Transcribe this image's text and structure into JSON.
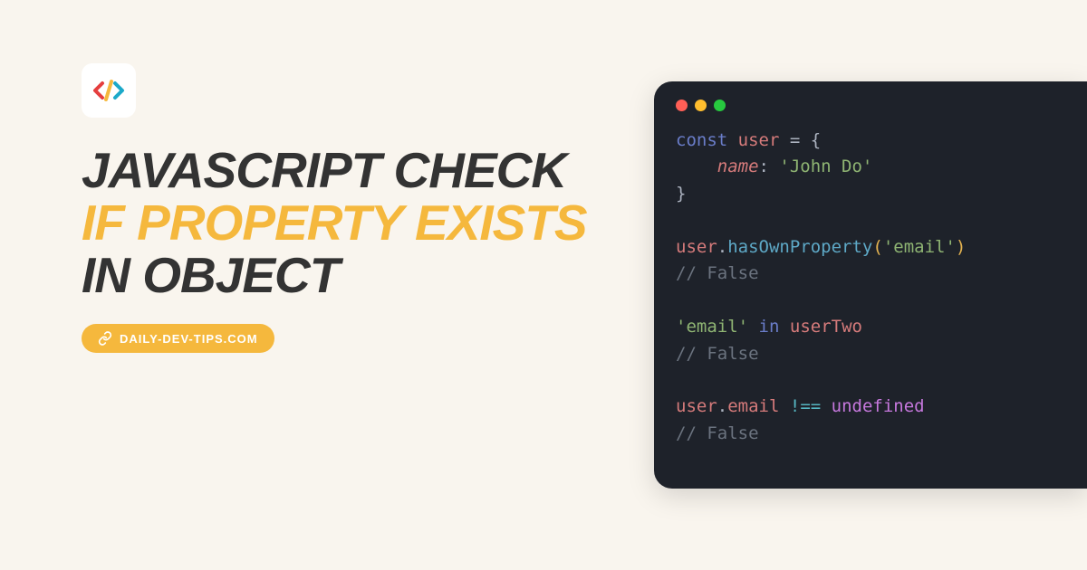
{
  "title": {
    "part1": "JAVASCRIPT CHECK ",
    "highlight": "IF PROPERTY EXISTS",
    "part2": " IN OBJECT"
  },
  "badge": {
    "text": "DAILY-DEV-TIPS.COM"
  },
  "colors": {
    "accent": "#f5b83d",
    "dark": "#333333",
    "bg": "#f9f5ee",
    "codeBg": "#1e222a"
  },
  "logo": {
    "leftArrow": "#e53e3e",
    "slash": "#f5b83d",
    "rightArrow": "#1ca9c9"
  },
  "trafficLights": [
    {
      "name": "red",
      "color": "#ff5f56"
    },
    {
      "name": "yellow",
      "color": "#ffbd2e"
    },
    {
      "name": "green",
      "color": "#27c93f"
    }
  ],
  "code": {
    "line1": {
      "const": "const",
      "var": "user",
      "eq": " = ",
      "brace": "{"
    },
    "line2": {
      "indent": "    ",
      "prop": "name",
      "colon": ": ",
      "str": "'John Do'"
    },
    "line3": {
      "brace": "}"
    },
    "line5": {
      "var": "user",
      "dot": ".",
      "method": "hasOwnProperty",
      "lparen": "(",
      "str": "'email'",
      "rparen": ")"
    },
    "line6": {
      "comment": "// False"
    },
    "line8": {
      "str": "'email'",
      "space1": " ",
      "in": "in",
      "space2": " ",
      "var": "userTwo"
    },
    "line9": {
      "comment": "// False"
    },
    "line11": {
      "var": "user",
      "dot": ".",
      "prop": "email",
      "space": " ",
      "strict": "!==",
      "space2": " ",
      "undef": "undefined"
    },
    "line12": {
      "comment": "// False"
    }
  }
}
